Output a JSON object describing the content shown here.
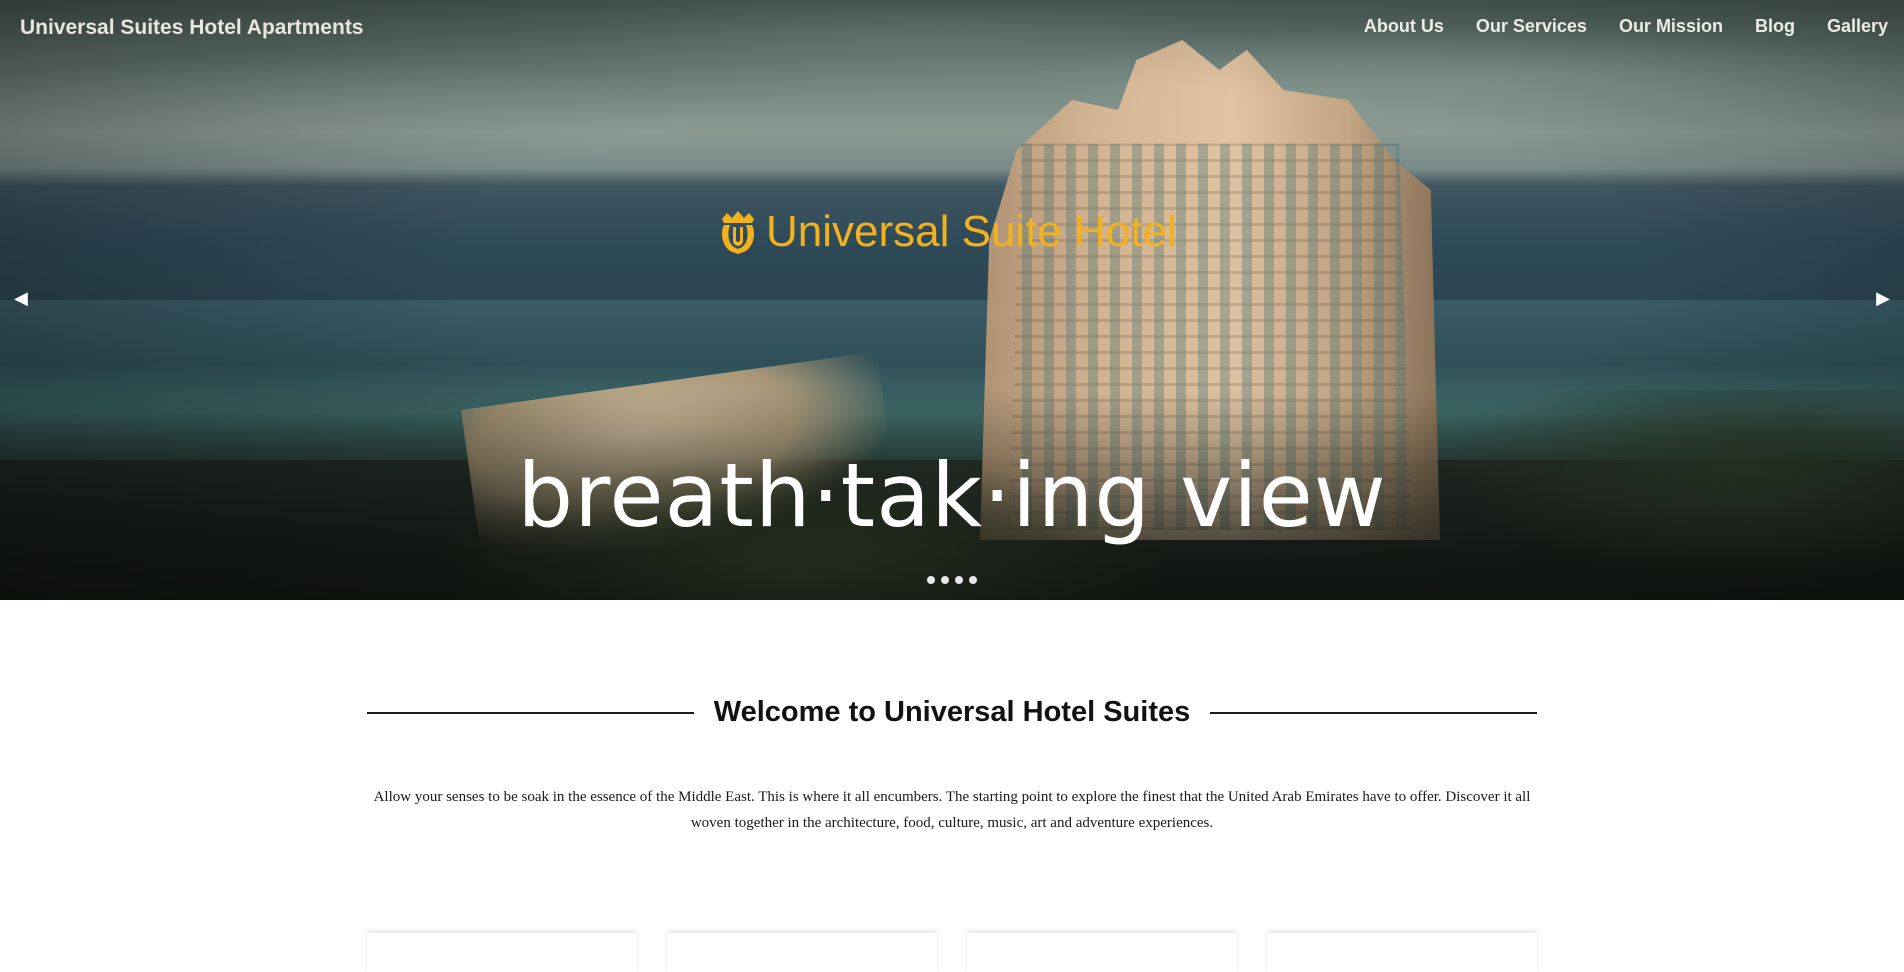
{
  "navbar": {
    "brand": "Universal Suites Hotel Apartments",
    "links": [
      "About Us",
      "Our Services",
      "Our Mission",
      "Blog",
      "Gallery"
    ]
  },
  "hero": {
    "logo_text": "Universal Suite Hotel",
    "logo_icon": "crown-crest-icon",
    "tagline": "breath·tak·ing view",
    "prev_icon": "◀",
    "next_icon": "▶",
    "slide_count": 4,
    "accent_color": "#f2b21e"
  },
  "welcome": {
    "title": "Welcome to Universal Hotel Suites",
    "text": "Allow your senses to be soak in the essence of the Middle East. This is where it all encumbers. The starting point to explore the finest that the United Arab Emirates have to offer. Discover it all woven together in the architecture, food, culture, music, art and adventure experiences."
  }
}
